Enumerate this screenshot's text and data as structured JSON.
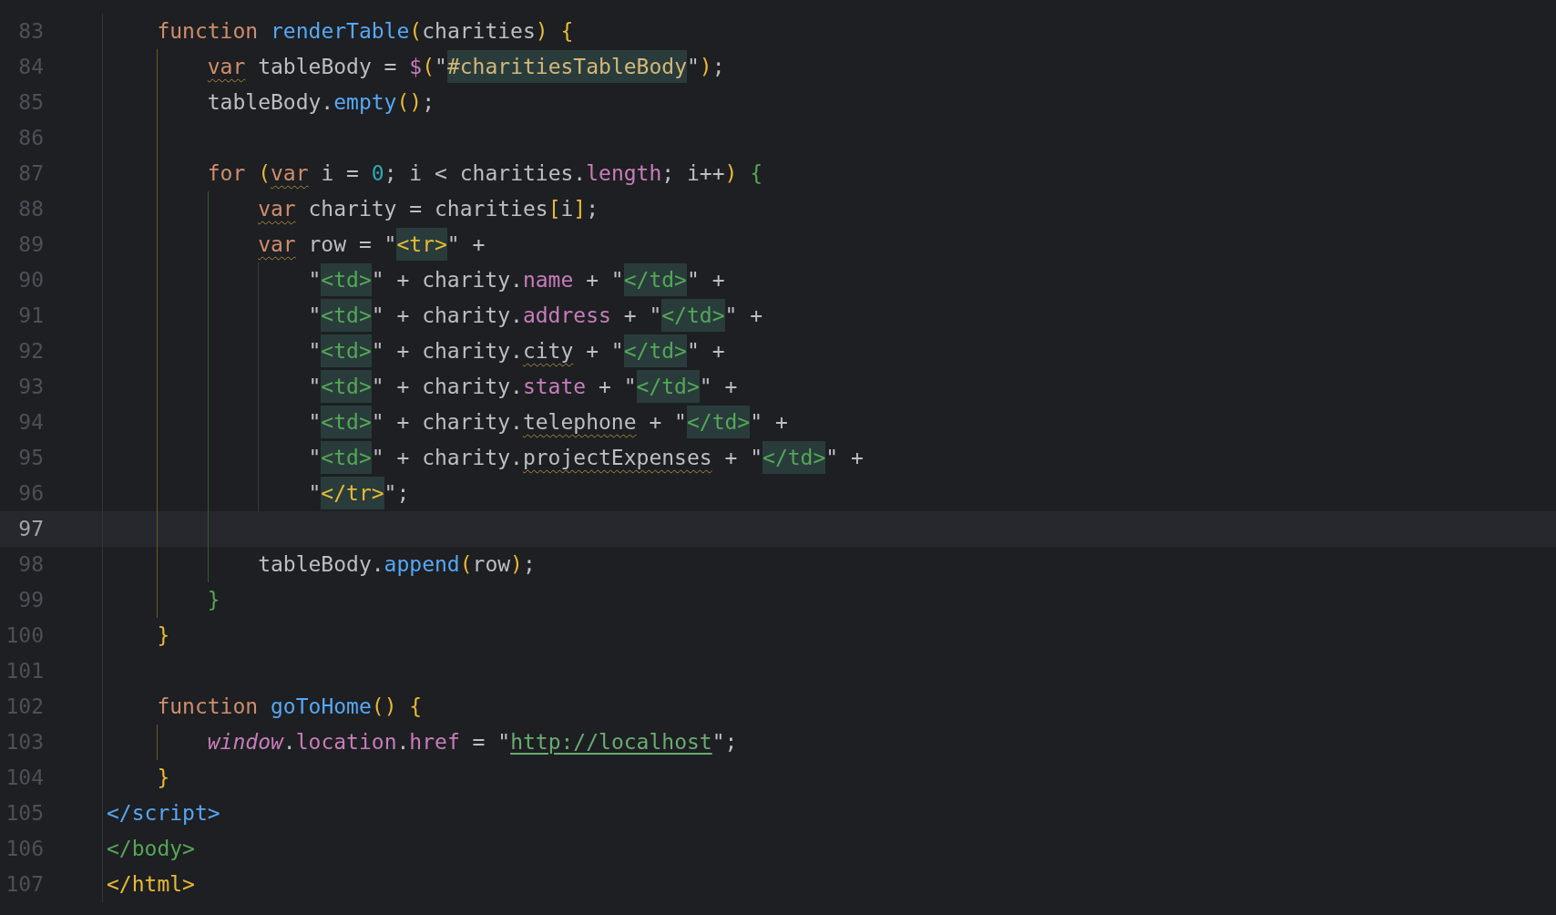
{
  "editor": {
    "lines": [
      {
        "number": "83",
        "current": false,
        "tokens": [
          {
            "text": "    function ",
            "kind": "keyword"
          },
          {
            "text": "renderTable",
            "kind": "function"
          },
          {
            "text": "(",
            "kind": "paren1"
          },
          {
            "text": "charities",
            "kind": "text"
          },
          {
            "text": ") {",
            "kind": "paren1"
          }
        ]
      },
      {
        "number": "84",
        "current": false,
        "tokens": [
          {
            "text": "        var",
            "kind": "keyword-warn"
          },
          {
            "text": " tableBody = ",
            "kind": "text"
          },
          {
            "text": "$",
            "kind": "field"
          },
          {
            "text": "(",
            "kind": "paren1"
          },
          {
            "text": "\"",
            "kind": "text"
          },
          {
            "text": "#charitiesTableBody",
            "kind": "selector"
          },
          {
            "text": "\"",
            "kind": "text"
          },
          {
            "text": ")",
            "kind": "paren1"
          },
          {
            "text": ";",
            "kind": "text"
          }
        ]
      },
      {
        "number": "85",
        "current": false,
        "tokens": [
          {
            "text": "        tableBody.",
            "kind": "text"
          },
          {
            "text": "empty",
            "kind": "function"
          },
          {
            "text": "()",
            "kind": "paren1"
          },
          {
            "text": ";",
            "kind": "text"
          }
        ]
      },
      {
        "number": "86",
        "current": false
      },
      {
        "number": "87",
        "current": false,
        "tokens": [
          {
            "text": "        for ",
            "kind": "keyword"
          },
          {
            "text": "(",
            "kind": "paren1"
          },
          {
            "text": "var",
            "kind": "keyword-warn"
          },
          {
            "text": " i = ",
            "kind": "text"
          },
          {
            "text": "0",
            "kind": "number"
          },
          {
            "text": "; i < charities.",
            "kind": "text"
          },
          {
            "text": "length",
            "kind": "field"
          },
          {
            "text": "; i++",
            "kind": "text"
          },
          {
            "text": ")",
            "kind": "paren1"
          },
          {
            "text": " {",
            "kind": "paren3"
          }
        ]
      },
      {
        "number": "88",
        "current": false,
        "tokens": [
          {
            "text": "            var",
            "kind": "keyword-warn"
          },
          {
            "text": " charity = charities",
            "kind": "text"
          },
          {
            "text": "[",
            "kind": "paren1"
          },
          {
            "text": "i",
            "kind": "text"
          },
          {
            "text": "]",
            "kind": "paren1"
          },
          {
            "text": ";",
            "kind": "text"
          }
        ]
      },
      {
        "number": "89",
        "current": false,
        "tokens": [
          {
            "text": "            var",
            "kind": "keyword-warn"
          },
          {
            "text": " row = \"",
            "kind": "text"
          },
          {
            "text": "<tr>",
            "kind": "inj-tag1"
          },
          {
            "text": "\" +",
            "kind": "text"
          }
        ]
      },
      {
        "number": "90",
        "current": false,
        "tokens": [
          {
            "text": "                \"",
            "kind": "text"
          },
          {
            "text": "<td>",
            "kind": "inj-tag2"
          },
          {
            "text": "\" + charity.",
            "kind": "text"
          },
          {
            "text": "name",
            "kind": "field"
          },
          {
            "text": " + \"",
            "kind": "text"
          },
          {
            "text": "</td>",
            "kind": "inj-tag2"
          },
          {
            "text": "\" +",
            "kind": "text"
          }
        ]
      },
      {
        "number": "91",
        "current": false,
        "tokens": [
          {
            "text": "                \"",
            "kind": "text"
          },
          {
            "text": "<td>",
            "kind": "inj-tag2"
          },
          {
            "text": "\" + charity.",
            "kind": "text"
          },
          {
            "text": "address",
            "kind": "field"
          },
          {
            "text": " + \"",
            "kind": "text"
          },
          {
            "text": "</td>",
            "kind": "inj-tag2"
          },
          {
            "text": "\" +",
            "kind": "text"
          }
        ]
      },
      {
        "number": "92",
        "current": false,
        "tokens": [
          {
            "text": "                \"",
            "kind": "text"
          },
          {
            "text": "<td>",
            "kind": "inj-tag2"
          },
          {
            "text": "\" + charity.",
            "kind": "text"
          },
          {
            "text": "city",
            "kind": "text-warn"
          },
          {
            "text": " + \"",
            "kind": "text"
          },
          {
            "text": "</td>",
            "kind": "inj-tag2"
          },
          {
            "text": "\" +",
            "kind": "text"
          }
        ]
      },
      {
        "number": "93",
        "current": false,
        "tokens": [
          {
            "text": "                \"",
            "kind": "text"
          },
          {
            "text": "<td>",
            "kind": "inj-tag2"
          },
          {
            "text": "\" + charity.",
            "kind": "text"
          },
          {
            "text": "state",
            "kind": "field"
          },
          {
            "text": " + \"",
            "kind": "text"
          },
          {
            "text": "</td>",
            "kind": "inj-tag2"
          },
          {
            "text": "\" +",
            "kind": "text"
          }
        ]
      },
      {
        "number": "94",
        "current": false,
        "tokens": [
          {
            "text": "                \"",
            "kind": "text"
          },
          {
            "text": "<td>",
            "kind": "inj-tag2"
          },
          {
            "text": "\" + charity.",
            "kind": "text"
          },
          {
            "text": "telephone",
            "kind": "text-warn"
          },
          {
            "text": " + \"",
            "kind": "text"
          },
          {
            "text": "</td>",
            "kind": "inj-tag2"
          },
          {
            "text": "\" +",
            "kind": "text"
          }
        ]
      },
      {
        "number": "95",
        "current": false,
        "tokens": [
          {
            "text": "                \"",
            "kind": "text"
          },
          {
            "text": "<td>",
            "kind": "inj-tag2"
          },
          {
            "text": "\" + charity.",
            "kind": "text"
          },
          {
            "text": "projectExpenses",
            "kind": "text-warn"
          },
          {
            "text": " + \"",
            "kind": "text"
          },
          {
            "text": "</td>",
            "kind": "inj-tag2"
          },
          {
            "text": "\" +",
            "kind": "text"
          }
        ]
      },
      {
        "number": "96",
        "current": false,
        "tokens": [
          {
            "text": "                \"",
            "kind": "text"
          },
          {
            "text": "</tr>",
            "kind": "inj-tag1"
          },
          {
            "text": "\";",
            "kind": "text"
          }
        ]
      },
      {
        "number": "97",
        "current": true
      },
      {
        "number": "98",
        "current": false,
        "tokens": [
          {
            "text": "            tableBody.",
            "kind": "text"
          },
          {
            "text": "append",
            "kind": "function"
          },
          {
            "text": "(",
            "kind": "paren1"
          },
          {
            "text": "row",
            "kind": "text"
          },
          {
            "text": ")",
            "kind": "paren1"
          },
          {
            "text": ";",
            "kind": "text"
          }
        ]
      },
      {
        "number": "99",
        "current": false,
        "tokens": [
          {
            "text": "        }",
            "kind": "paren3"
          }
        ]
      },
      {
        "number": "100",
        "current": false,
        "tokens": [
          {
            "text": "    }",
            "kind": "paren1"
          }
        ]
      },
      {
        "number": "101",
        "current": false
      },
      {
        "number": "102",
        "current": false,
        "tokens": [
          {
            "text": "    function ",
            "kind": "keyword"
          },
          {
            "text": "goToHome",
            "kind": "function"
          },
          {
            "text": "() {",
            "kind": "paren1"
          }
        ]
      },
      {
        "number": "103",
        "current": false,
        "tokens": [
          {
            "text": "        window",
            "kind": "global"
          },
          {
            "text": ".",
            "kind": "text"
          },
          {
            "text": "location",
            "kind": "field"
          },
          {
            "text": ".",
            "kind": "text"
          },
          {
            "text": "href",
            "kind": "field"
          },
          {
            "text": " = \"",
            "kind": "text"
          },
          {
            "text": "http://localhost",
            "kind": "url"
          },
          {
            "text": "\";",
            "kind": "text"
          }
        ]
      },
      {
        "number": "104",
        "current": false,
        "tokens": [
          {
            "text": "    }",
            "kind": "paren1"
          }
        ]
      },
      {
        "number": "105",
        "current": false,
        "tokens": [
          {
            "text": "</script>",
            "kind": "tag3"
          }
        ]
      },
      {
        "number": "106",
        "current": false,
        "tokens": [
          {
            "text": "</body>",
            "kind": "tag2"
          }
        ]
      },
      {
        "number": "107",
        "current": false,
        "tokens": [
          {
            "text": "</html>",
            "kind": "tag1"
          }
        ]
      }
    ]
  }
}
